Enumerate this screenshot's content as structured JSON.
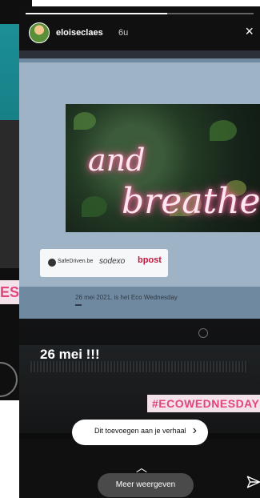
{
  "background_story": {
    "tag_partial": "ESD"
  },
  "story": {
    "user": {
      "username": "eloiseclaes",
      "time": "6u"
    },
    "screen": {
      "neon_line_1": "and",
      "neon_line_2": "breathe",
      "logos": [
        "SafeDriven.be",
        "sodexo",
        "bpost"
      ],
      "date_text": "26 mei 2021, is het Eco Wednesday"
    },
    "caption": "26 mei !!!",
    "hashtag": "#ECOWEDNESDAY",
    "add_to_story_label": "Dit toevoegen aan je verhaal",
    "more_label": "Meer weergeven"
  },
  "icons": {
    "close": "close-icon",
    "add_chevron": "chevron-right-icon",
    "more_chevron": "chevron-up-icon",
    "share": "send-icon"
  },
  "colors": {
    "hashtag": "#e0457e",
    "hashtag_bg": "#f4e2ea",
    "teal": "#1c8f96"
  }
}
